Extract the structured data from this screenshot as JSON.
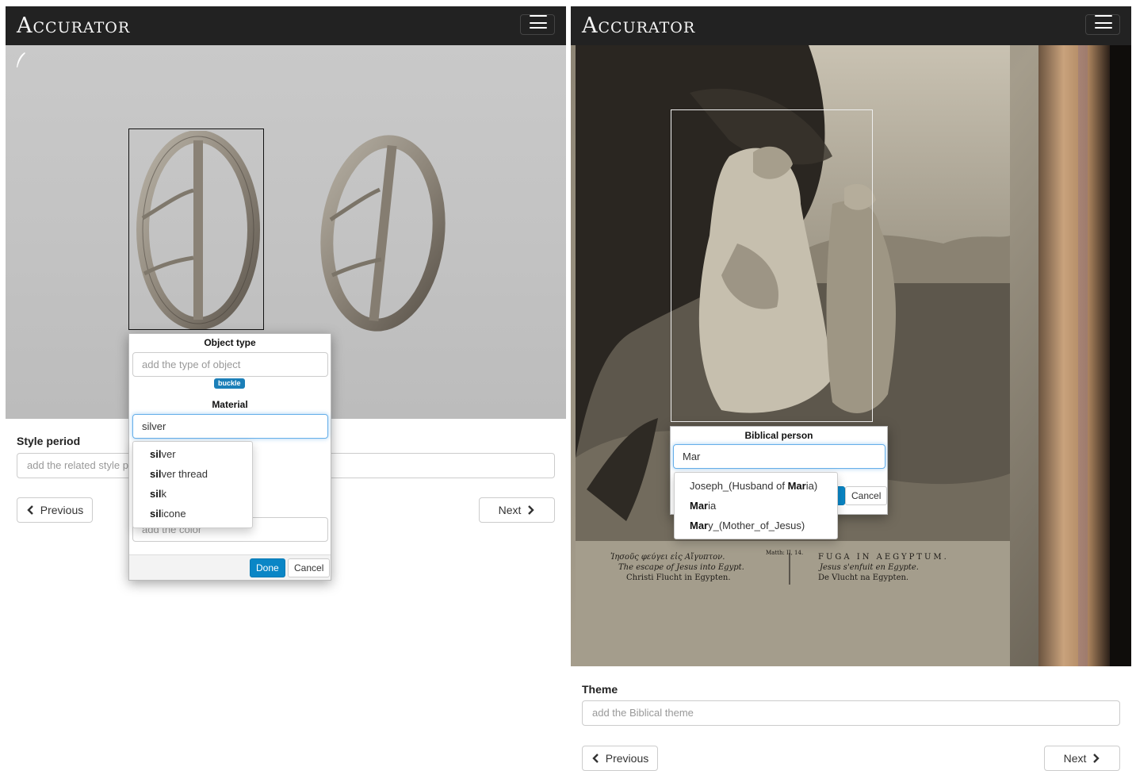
{
  "left": {
    "brand": "Accurator",
    "popover": {
      "object_type_title": "Object type",
      "object_type_placeholder": "add the type of object",
      "object_type_tag": "buckle",
      "material_title": "Material",
      "material_value": "silver",
      "color_placeholder": "add the color",
      "done_label": "Done",
      "cancel_label": "Cancel",
      "suggestions": [
        {
          "match": "sil",
          "rest": "ver"
        },
        {
          "match": "sil",
          "rest": "ver thread"
        },
        {
          "match": "sil",
          "rest": "k"
        },
        {
          "match": "sil",
          "rest": "icone"
        }
      ]
    },
    "style_period_label": "Style period",
    "style_period_placeholder": "add the related style p",
    "previous_label": "Previous",
    "next_label": "Next"
  },
  "right": {
    "brand": "Accurator",
    "popover": {
      "title": "Biblical person",
      "value": "Mar",
      "cancel_label": "Cancel",
      "suggestions": [
        {
          "pre": "Joseph_(Husband of ",
          "match": "Mar",
          "post": "ia)"
        },
        {
          "pre": "",
          "match": "Mar",
          "post": "ia"
        },
        {
          "pre": "",
          "match": "Mar",
          "post": "y_(Mother_of_Jesus)"
        }
      ]
    },
    "engraving_caption": {
      "greek": "Ἰησοῦς φεύγει εἰς Αἴγυπτον.",
      "english": "The escape of Jesus into Egypt.",
      "german": "Christi Flucht in Egypten.",
      "reference": "Matth: II, 14.",
      "latin": "FUGA IN AEGYPTUM.",
      "french": "Jesus s'enfuit en Egypte.",
      "dutch": "De Vlucht na Egypten."
    },
    "theme_label": "Theme",
    "theme_placeholder": "add the Biblical theme",
    "previous_label": "Previous",
    "next_label": "Next"
  }
}
